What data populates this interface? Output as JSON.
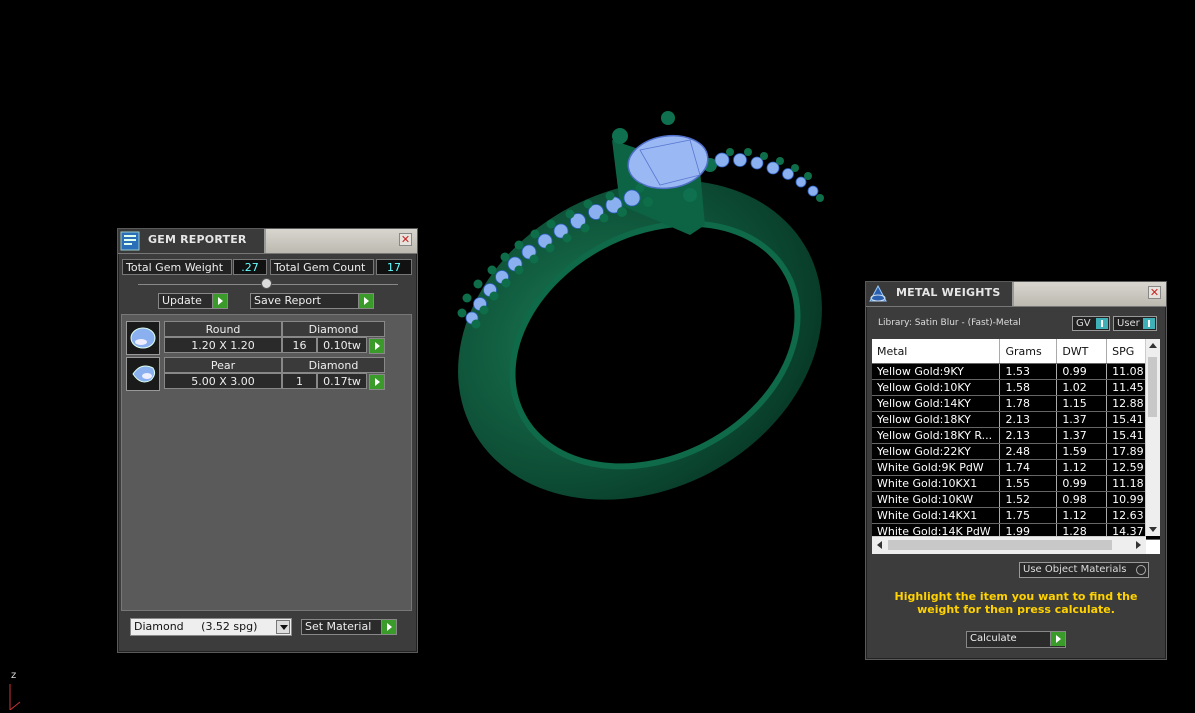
{
  "gem_reporter": {
    "title": "GEM REPORTER",
    "close_symbol": "✕",
    "total_weight_label": "Total Gem Weight",
    "total_weight_value": ".27",
    "total_count_label": "Total Gem Count",
    "total_count_value": "17",
    "update_label": "Update",
    "save_report_label": "Save Report",
    "gems": [
      {
        "shape": "Round",
        "material": "Diamond",
        "size": "1.20 X 1.20",
        "count": "16",
        "weight": "0.10tw"
      },
      {
        "shape": "Pear",
        "material": "Diamond",
        "size": "5.00 X 3.00",
        "count": "1",
        "weight": "0.17tw"
      }
    ],
    "material_select": "Diamond     (3.52 spg)",
    "set_material_label": "Set Material"
  },
  "metal_weights": {
    "title": "METAL WEIGHTS",
    "close_symbol": "✕",
    "library_text": "Library: Satin Blur - (Fast)-Metal",
    "gv_label": "GV",
    "user_label": "User",
    "columns": [
      "Metal",
      "Grams",
      "DWT",
      "SPG"
    ],
    "rows": [
      [
        "Yellow Gold:9KY",
        "1.53",
        "0.99",
        "11.08"
      ],
      [
        "Yellow Gold:10KY",
        "1.58",
        "1.02",
        "11.45"
      ],
      [
        "Yellow Gold:14KY",
        "1.78",
        "1.15",
        "12.88"
      ],
      [
        "Yellow Gold:18KY",
        "2.13",
        "1.37",
        "15.41"
      ],
      [
        "Yellow Gold:18KY R...",
        "2.13",
        "1.37",
        "15.41"
      ],
      [
        "Yellow Gold:22KY",
        "2.48",
        "1.59",
        "17.89"
      ],
      [
        "White Gold:9K PdW",
        "1.74",
        "1.12",
        "12.59"
      ],
      [
        "White Gold:10KX1",
        "1.55",
        "0.99",
        "11.18"
      ],
      [
        "White Gold:10KW",
        "1.52",
        "0.98",
        "10.99"
      ],
      [
        "White Gold:14KX1",
        "1.75",
        "1.12",
        "12.63"
      ],
      [
        "White Gold:14K PdW",
        "1.99",
        "1.28",
        "14.37"
      ]
    ],
    "use_object_materials_label": "Use Object Materials",
    "help_text": "Highlight the item you want to find the weight for then press calculate.",
    "calculate_label": "Calculate"
  },
  "viewport": {
    "axis_label": "z"
  },
  "colors": {
    "metal": "#0b5a3c",
    "gem": "#8ab0f0",
    "help_text": "#ffd200",
    "accent_green": "#3a9a2a"
  }
}
